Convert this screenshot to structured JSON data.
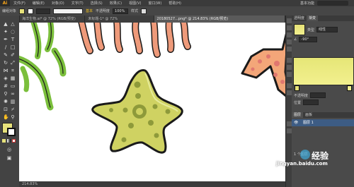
{
  "app": {
    "logo": "Ai"
  },
  "menu": {
    "items": [
      "文件(F)",
      "编辑(E)",
      "对象(O)",
      "文字(T)",
      "选择(S)",
      "效果(C)",
      "视图(V)",
      "窗口(W)",
      "帮助(H)"
    ],
    "workspace": "基本功能"
  },
  "control_bar": {
    "label": "编组对象",
    "stroke_label": "基本",
    "opacity_label": "不透明度",
    "opacity_value": "100%",
    "style_label": "样式"
  },
  "tabs": [
    {
      "label": "海洋生物.ai* @ 72% (RGB/预览)",
      "active": false
    },
    {
      "label": "未标题-1* @ 72%",
      "active": false
    },
    {
      "label": "20180527...png* @ 214.83% (RGB/预览)",
      "active": true
    }
  ],
  "status": {
    "text": "214.83%"
  },
  "panels": {
    "color_tabs": [
      "颜色",
      "色板"
    ],
    "gradient_tabs": [
      "透明度",
      "渐变"
    ],
    "type_label": "类型",
    "type_value": "线性",
    "angle_value": "-90°",
    "opacity_label": "不透明度",
    "location_label": "位置",
    "layers_tabs": [
      "图层",
      "画板"
    ],
    "layer_name": "图层 1",
    "layer_count": "1 个图层"
  },
  "watermark": {
    "site": "jingyan.baidu.com",
    "brand": "经验"
  },
  "colors": {
    "fill": "#e6e17a",
    "star_green": "#cfd262",
    "star_green_dark": "#8e9a3a",
    "star_orange": "#f3a679",
    "star_orange_dark": "#e0776f",
    "seaweed": "#7bbf3c",
    "coral": "#ee9a7a",
    "selection": "#3d5c84"
  }
}
